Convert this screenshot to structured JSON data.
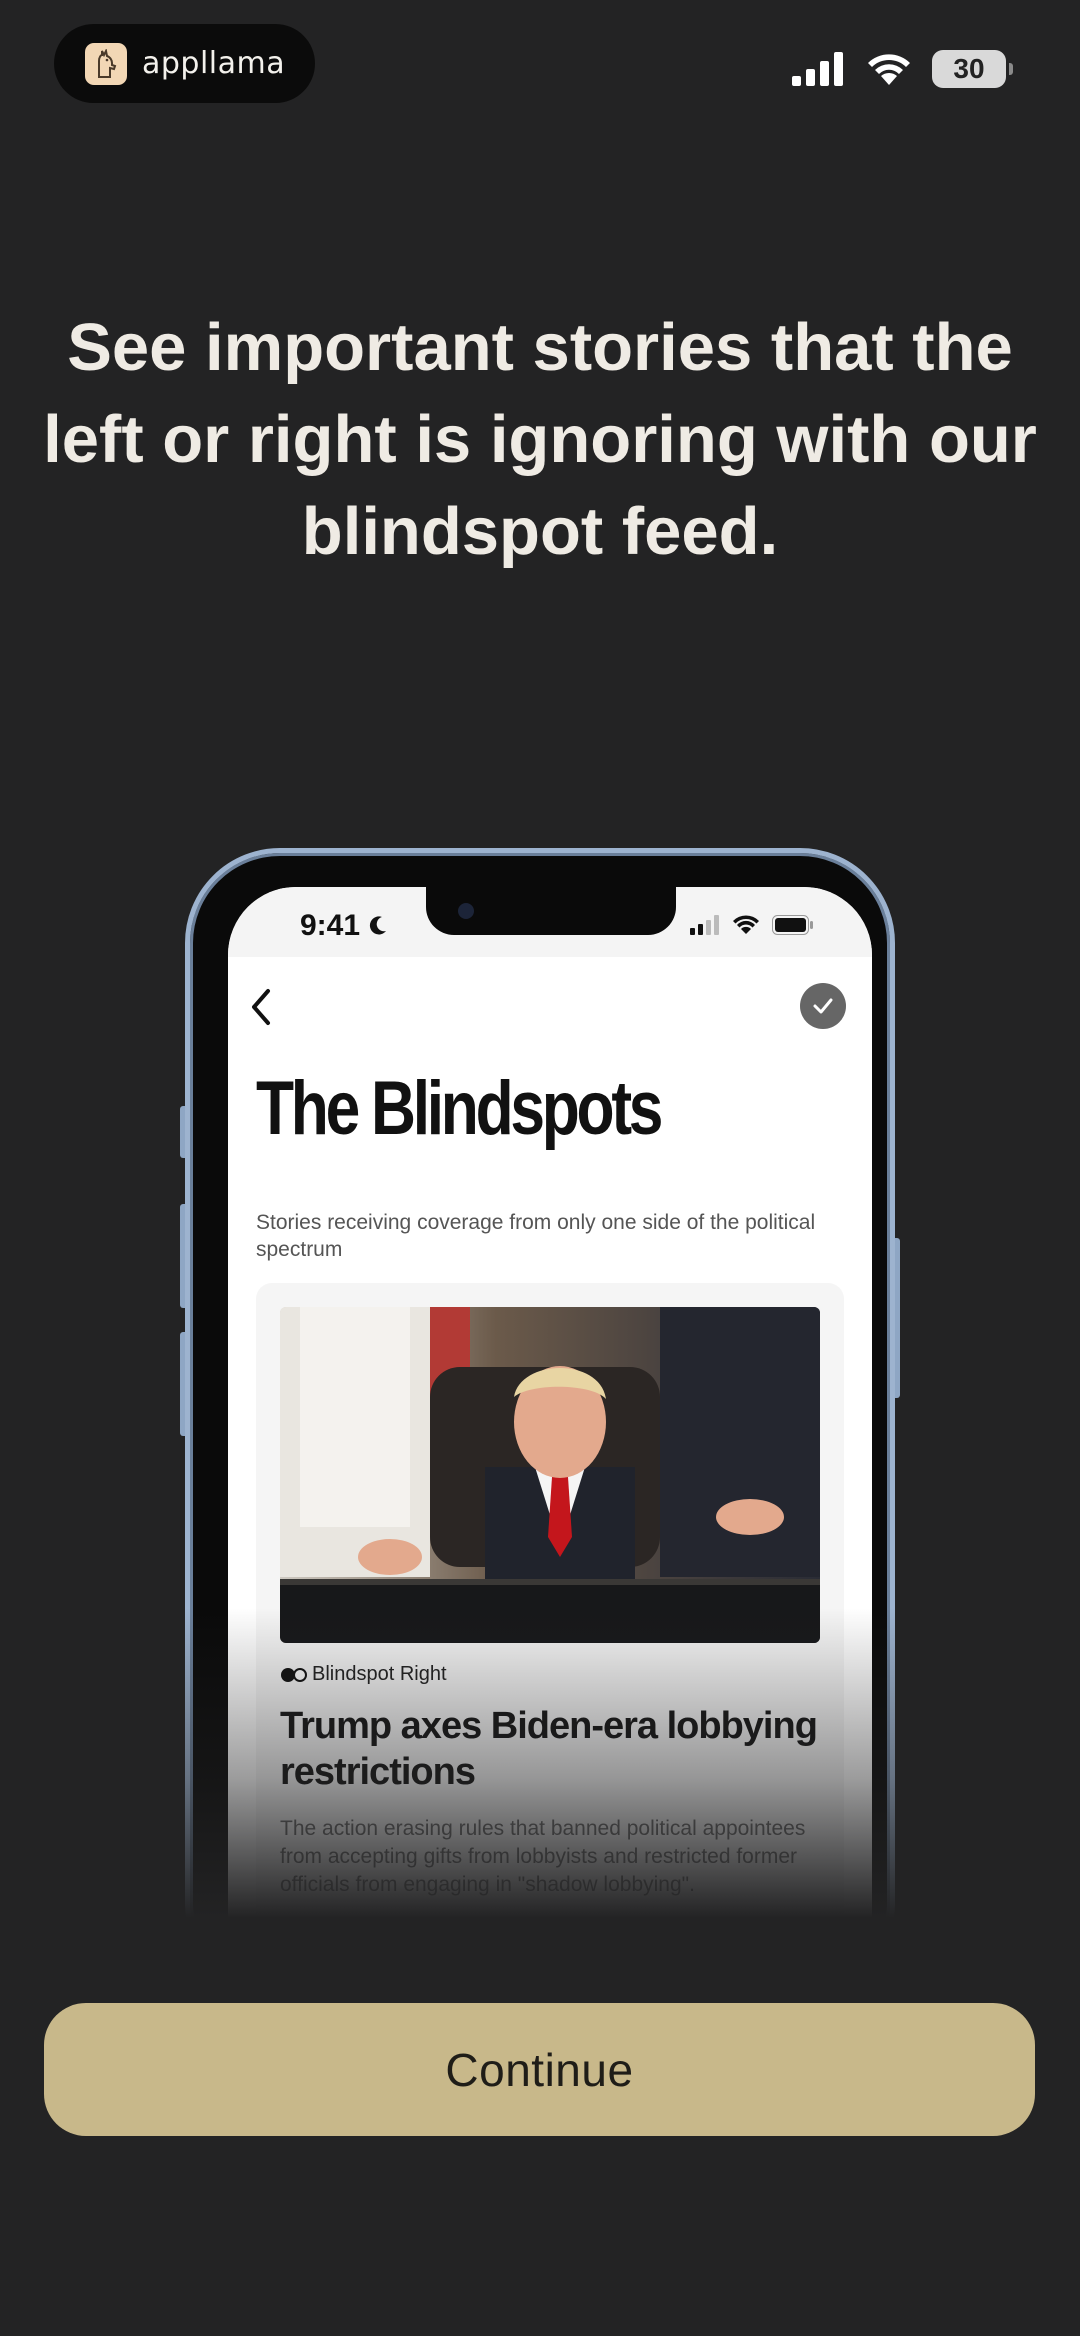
{
  "status_bar": {
    "app_name": "appllama",
    "battery": "30",
    "icons": [
      "cellular-signal-icon",
      "wifi-icon",
      "battery-icon"
    ]
  },
  "headline": "See important stories that the left or right is ignoring with our blindspot feed.",
  "phone_preview": {
    "time": "9:41",
    "screen_title": "The Blindspots",
    "screen_subtitle": "Stories receiving coverage from only one side of the political spectrum",
    "card": {
      "tag": "Blindspot Right",
      "headline": "Trump axes Biden-era lobbying restrictions",
      "description": "The action erasing rules that banned political appointees from accepting gifts from lobbyists and restricted former officials from engaging in \"shadow lobbying\"."
    }
  },
  "continue_label": "Continue",
  "colors": {
    "background": "#232324",
    "button": "#c8b88a",
    "button_text": "#1f1d18",
    "headline_text": "#efebe4"
  }
}
